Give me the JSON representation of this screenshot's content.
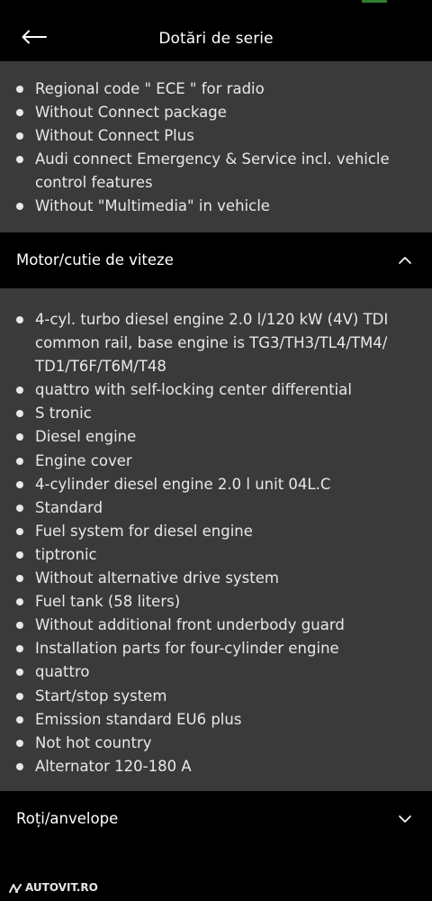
{
  "header": {
    "title": "Dotări de serie",
    "back_icon": "arrow-left-icon"
  },
  "colors": {
    "background": "#000000",
    "panel": "#3a3a3a",
    "text": "#e8e8e8"
  },
  "panel_top": {
    "items": [
      "Regional code \" ECE \" for radio",
      "Without Connect package",
      "Without Connect Plus",
      "Audi connect Emergency & Service incl. vehicle control features",
      "Without \"Multimedia\" in vehicle"
    ]
  },
  "sections": [
    {
      "title": "Motor/cutie de viteze",
      "icon": "chevron-up-icon",
      "expanded": true,
      "items": [
        "4-cyl. turbo diesel engine 2.0 l/120 kW (4V) TDI common rail, base engine is TG3/TH3/TL4/TM4/ TD1/T6F/T6M/T48",
        "quattro with self-locking center differential",
        "S tronic",
        "Diesel engine",
        "Engine cover",
        "4-cylinder diesel engine 2.0 l unit 04L.C",
        "Standard",
        "Fuel system for diesel engine",
        "tiptronic",
        "Without alternative drive system",
        "Fuel tank (58 liters)",
        "Without additional front underbody guard",
        "Installation parts for four-cylinder engine",
        "quattro",
        "Start/stop system",
        "Emission standard EU6 plus",
        "Not hot country",
        "Alternator 120-180 A"
      ]
    },
    {
      "title": "Roți/anvelope",
      "icon": "chevron-down-icon",
      "expanded": false
    }
  ],
  "watermark": {
    "text": "AUTOVIT.RO",
    "icon": "autovit-logo-icon"
  }
}
